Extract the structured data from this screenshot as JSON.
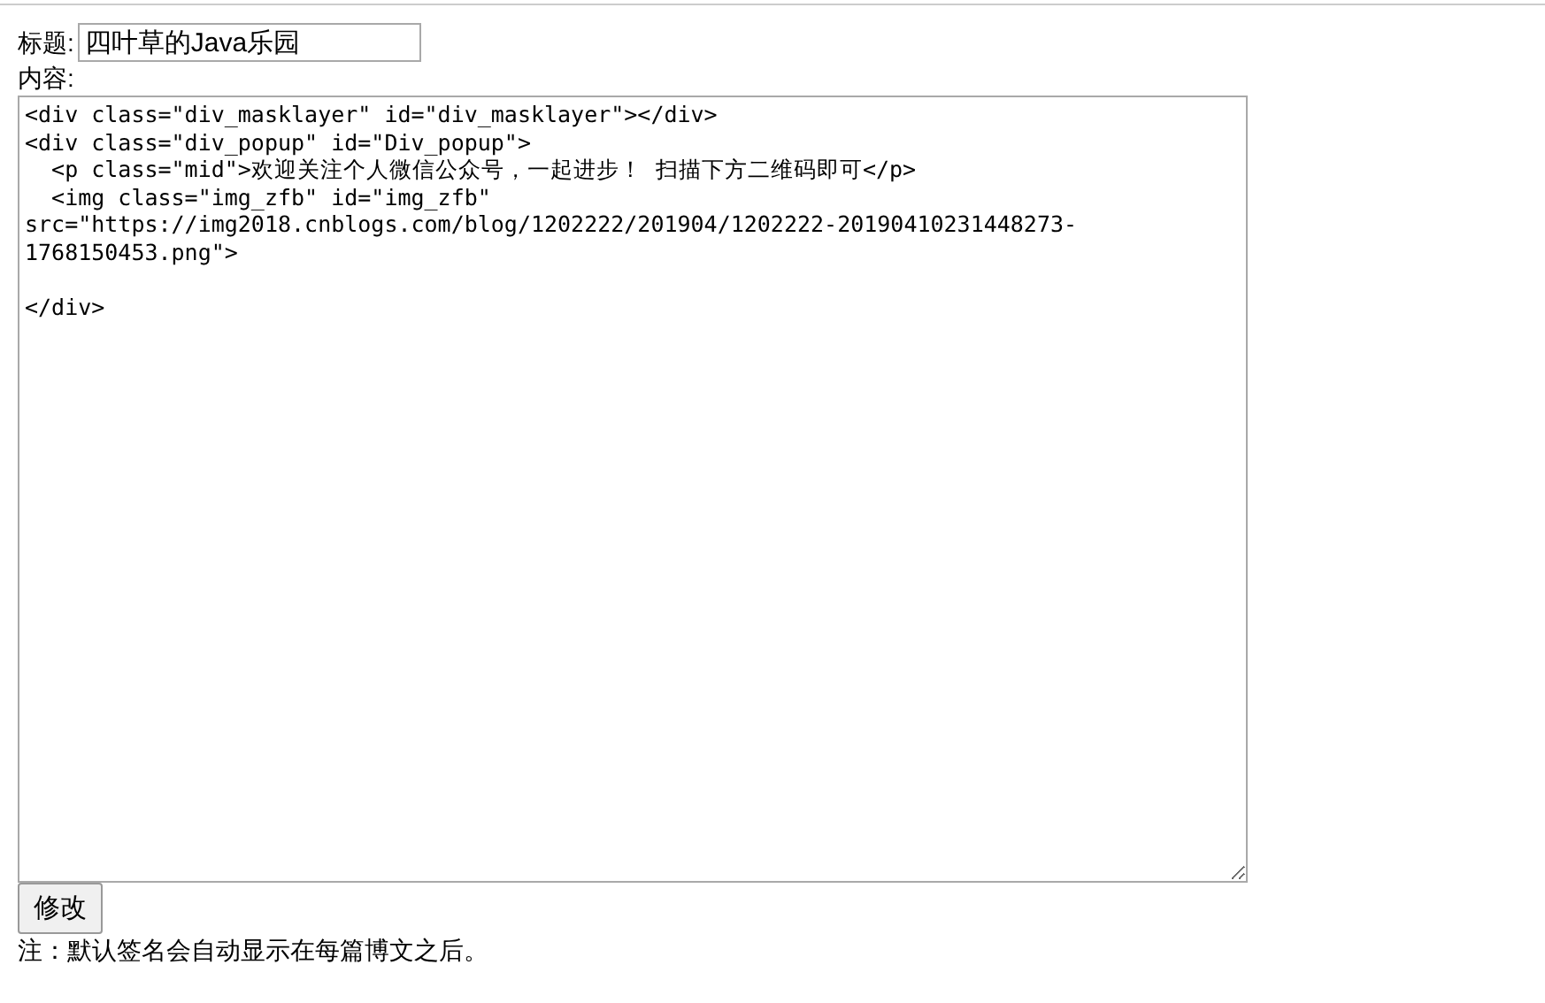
{
  "title_field": {
    "label": "标题:",
    "value": "四叶草的Java乐园"
  },
  "content_field": {
    "label": "内容:",
    "value": "<div class=\"div_masklayer\" id=\"div_masklayer\"></div>\n<div class=\"div_popup\" id=\"Div_popup\">\n  <p class=\"mid\">欢迎关注个人微信公众号，一起进步！ 扫描下方二维码即可</p>\n  <img class=\"img_zfb\" id=\"img_zfb\"\nsrc=\"https://img2018.cnblogs.com/blog/1202222/201904/1202222-20190410231448273-\n1768150453.png\">\n\n</div>"
  },
  "submit_button": "修改",
  "note": "注：默认签名会自动显示在每篇博文之后。"
}
